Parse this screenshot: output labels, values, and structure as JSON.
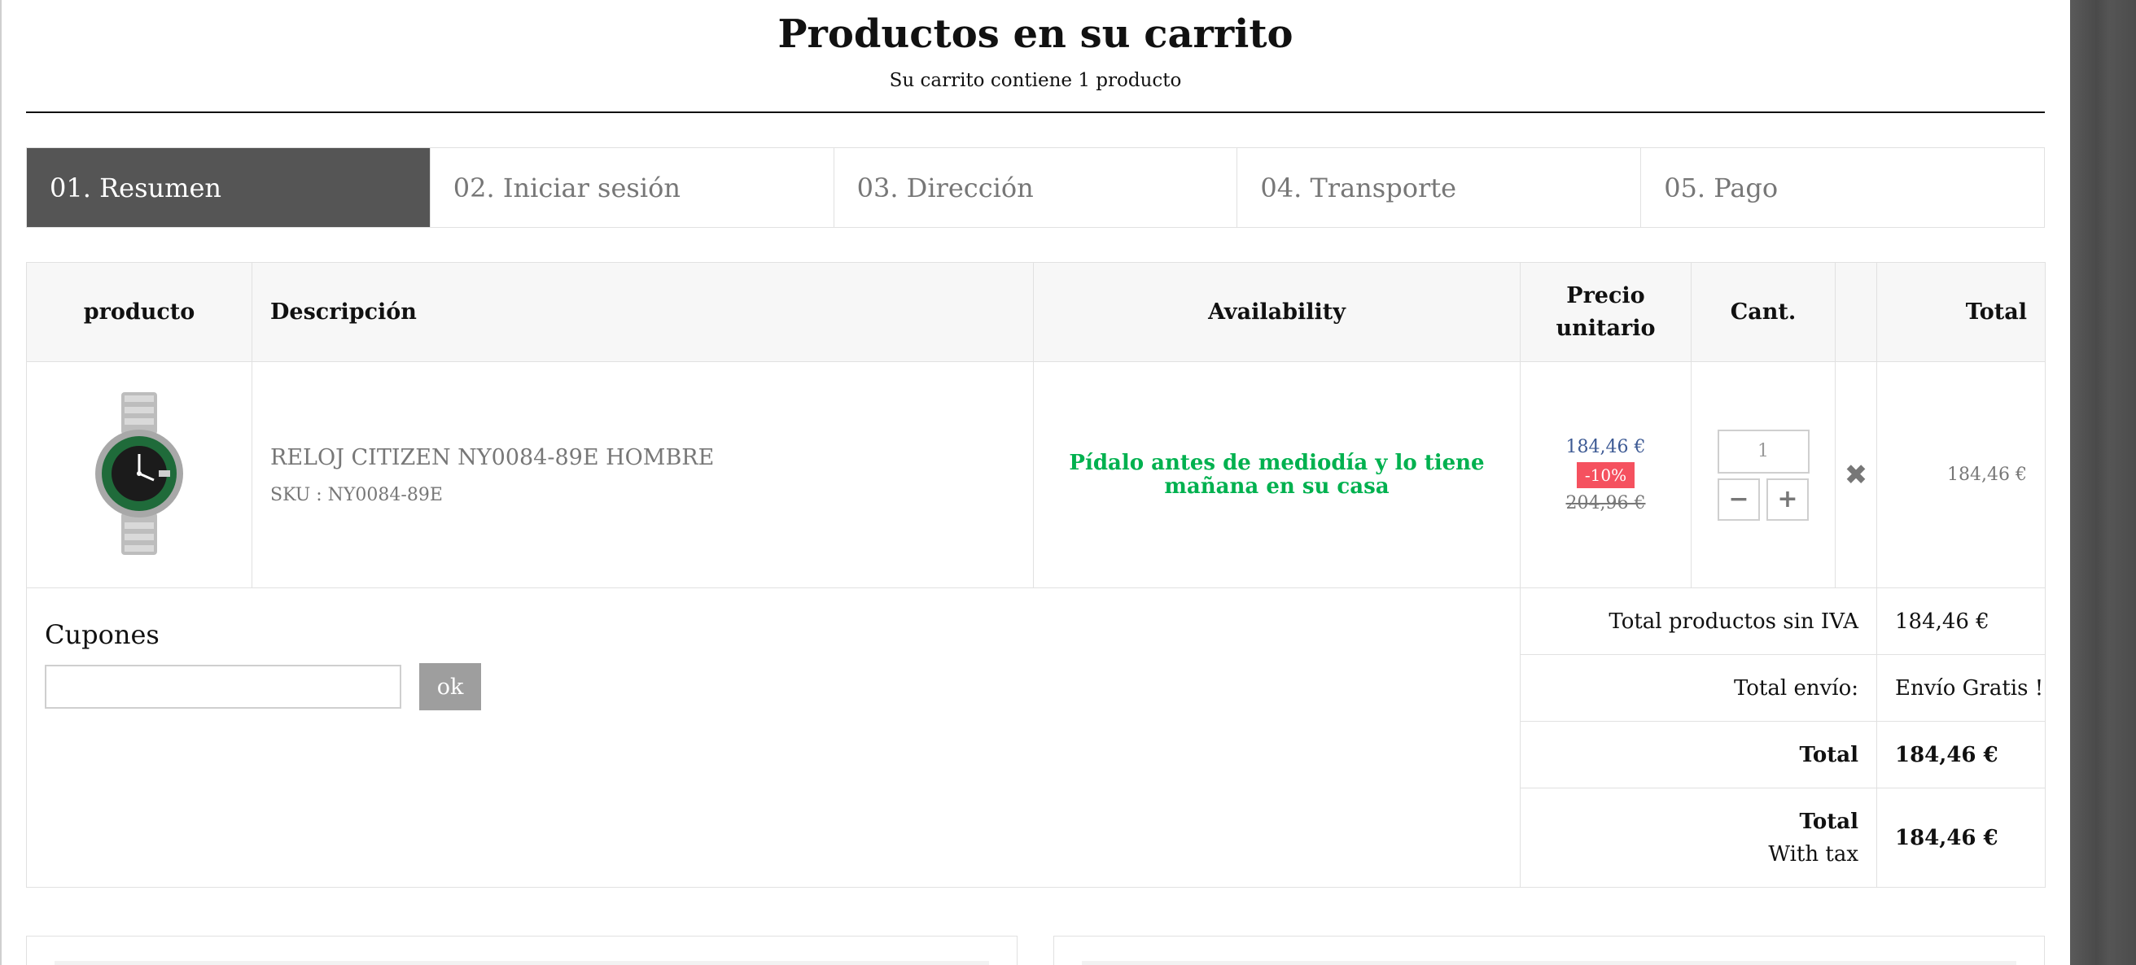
{
  "header": {
    "title": "Productos en su carrito",
    "subtitle": "Su carrito contiene 1 producto"
  },
  "steps": [
    {
      "label": "01. Resumen",
      "active": true
    },
    {
      "label": "02. Iniciar sesión",
      "active": false
    },
    {
      "label": "03. Dirección",
      "active": false
    },
    {
      "label": "04. Transporte",
      "active": false
    },
    {
      "label": "05. Pago",
      "active": false
    }
  ],
  "table": {
    "columns": {
      "product": "producto",
      "description": "Descripción",
      "availability": "Availability",
      "unit_price_line1": "Precio",
      "unit_price_line2": "unitario",
      "qty": "Cant.",
      "total": "Total"
    },
    "item": {
      "name": "RELOJ CITIZEN NY0084-89E HOMBRE",
      "sku": "SKU : NY0084-89E",
      "availability": "Pídalo antes de mediodía y lo tiene mañana en su casa",
      "price": "184,46 €",
      "discount": "-10%",
      "old_price": "204,96 €",
      "qty": "1",
      "minus": "−",
      "plus": "+",
      "delete": "✖",
      "total": "184,46 €"
    }
  },
  "coupons": {
    "title": "Cupones",
    "input_value": "",
    "button": "ok"
  },
  "summary": {
    "products_label": "Total productos sin IVA",
    "products_value": "184,46 €",
    "shipping_label": "Total envío:",
    "shipping_value": "Envío Gratis !",
    "total_label": "Total",
    "total_value": "184,46 €",
    "total_tax_label_line1": "Total",
    "total_tax_label_line2": "With tax",
    "total_tax_value": "184,46 €"
  },
  "colors": {
    "active_step": "#555555",
    "availability_green": "#00b14f",
    "price_blue": "#3d5a94",
    "discount_red": "#f5515f",
    "ok_button": "#9e9e9e"
  }
}
